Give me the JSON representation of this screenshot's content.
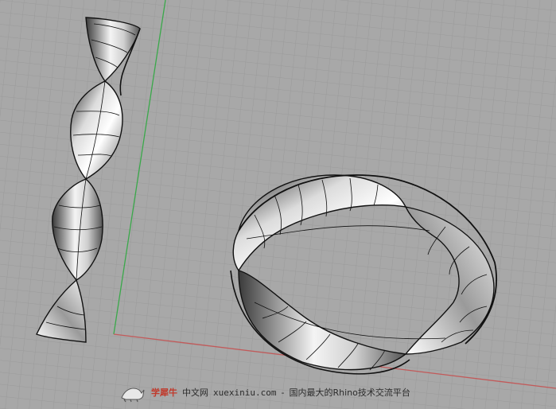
{
  "viewport": {
    "background_color": "#a8a8a8",
    "grid_color": "#9b9b9b",
    "x_axis_color": "#c25a5a",
    "y_axis_color": "#3aa84a"
  },
  "objects": [
    {
      "name": "twisted-strip"
    },
    {
      "name": "mobius-strip"
    }
  ],
  "watermark": {
    "brand": "学犀牛",
    "site_cn": "中文网",
    "url": "xuexiniu.com",
    "separator": "-",
    "slogan": "国内最大的Rhino技术交流平台",
    "logo_icon": "rhino-logo-icon"
  }
}
